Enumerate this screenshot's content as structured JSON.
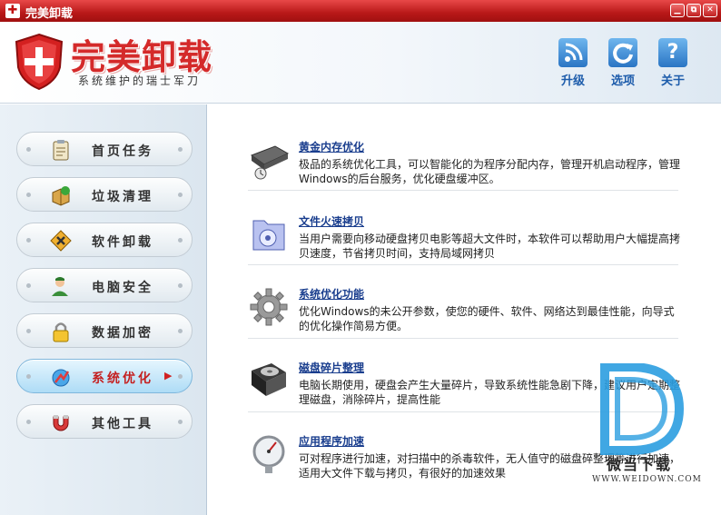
{
  "window": {
    "title": "完美卸载"
  },
  "header": {
    "brand": "完美卸载",
    "slogan": "系统维护的瑞士军刀",
    "tools": [
      {
        "label": "升级",
        "icon": "rss-icon"
      },
      {
        "label": "选项",
        "icon": "refresh-icon"
      },
      {
        "label": "关于",
        "icon": "help-icon"
      }
    ]
  },
  "sidebar": {
    "active_index": 5,
    "items": [
      {
        "label": "首页任务",
        "icon": "clipboard-icon"
      },
      {
        "label": "垃圾清理",
        "icon": "recycle-box-icon"
      },
      {
        "label": "软件卸载",
        "icon": "tools-icon"
      },
      {
        "label": "电脑安全",
        "icon": "user-shield-icon"
      },
      {
        "label": "数据加密",
        "icon": "lock-icon"
      },
      {
        "label": "系统优化",
        "icon": "optimize-icon"
      },
      {
        "label": "其他工具",
        "icon": "magnet-icon"
      }
    ]
  },
  "features": [
    {
      "title": "黄金内存优化",
      "desc": "极品的系统优化工具，可以智能化的为程序分配内存，管理开机启动程序，管理Windows的后台服务，优化硬盘缓冲区。",
      "icon": "memory-chip-icon"
    },
    {
      "title": "文件火速拷贝",
      "desc": "当用户需要向移动硬盘拷贝电影等超大文件时，本软件可以帮助用户大幅提高拷贝速度，节省拷贝时间，支持局域网拷贝",
      "icon": "folder-copy-icon"
    },
    {
      "title": "系统优化功能",
      "desc": "优化Windows的未公开参数，使您的硬件、软件、网络达到最佳性能，向导式的优化操作简易方便。",
      "icon": "gear-icon"
    },
    {
      "title": "磁盘碎片整理",
      "desc": "电脑长期使用，硬盘会产生大量碎片，导致系统性能急剧下降，建议用户定期整理磁盘，消除碎片，提高性能",
      "icon": "hard-disk-icon"
    },
    {
      "title": "应用程序加速",
      "desc": "可对程序进行加速，对扫描中的杀毒软件，无人值守的磁盘碎整理等进行加速，适用大文件下载与拷贝，有很好的加速效果",
      "icon": "gauge-icon"
    }
  ],
  "watermark": {
    "text": "微当下载",
    "url": "WWW.WEIDOWN.COM"
  }
}
